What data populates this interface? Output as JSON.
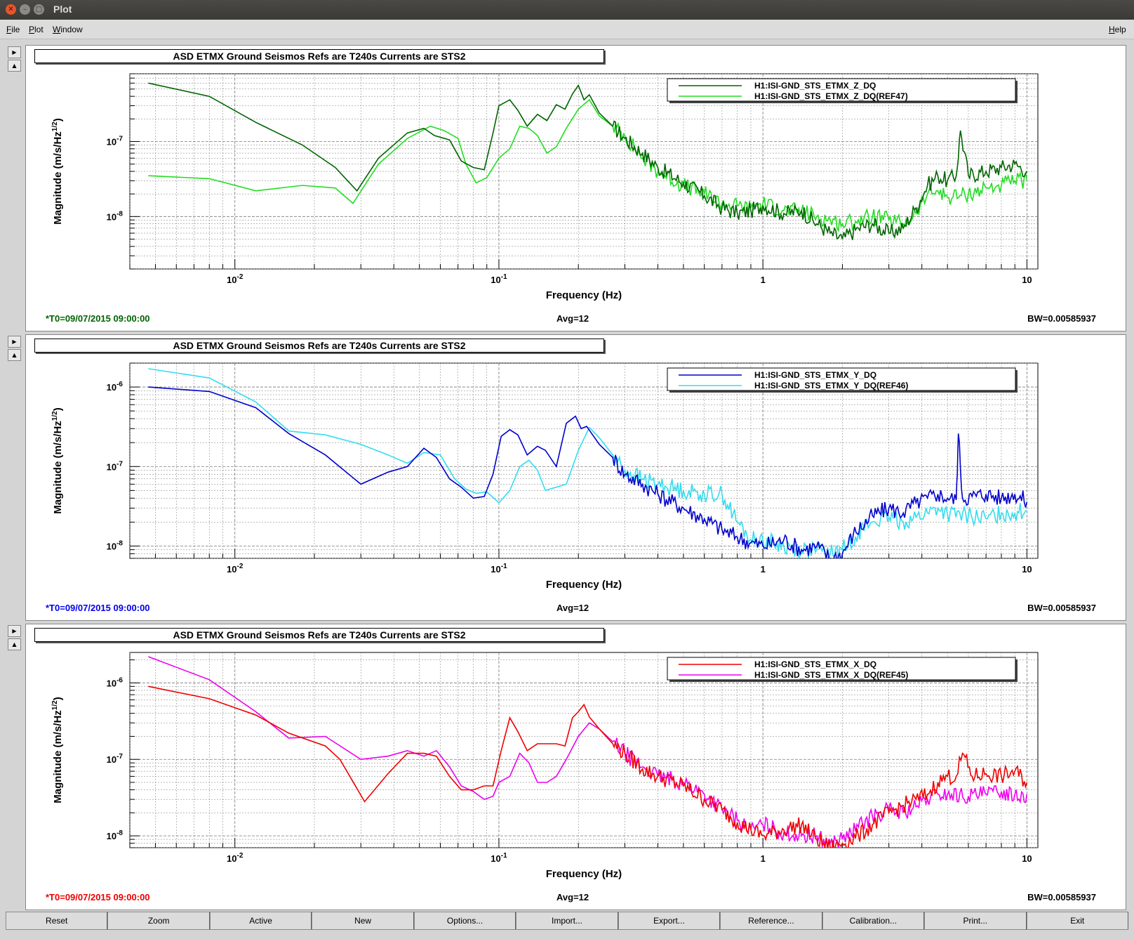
{
  "window": {
    "title": "Plot"
  },
  "menu": {
    "file": "File",
    "plot": "Plot",
    "window": "Window",
    "help": "Help"
  },
  "panels": [
    {
      "title": "ASD ETMX Ground Seismos Refs are T240s Currents are STS2",
      "t0": "*T0=09/07/2015 09:00:00",
      "avg": "Avg=12",
      "bw": "BW=0.00585937",
      "t0_color": "#006400"
    },
    {
      "title": "ASD ETMX Ground Seismos Refs are T240s Currents are STS2",
      "t0": "*T0=09/07/2015 09:00:00",
      "avg": "Avg=12",
      "bw": "BW=0.00585937",
      "t0_color": "#0000ee"
    },
    {
      "title": "ASD ETMX Ground Seismos Refs are T240s Currents are STS2",
      "t0": "*T0=09/07/2015 09:00:00",
      "avg": "Avg=12",
      "bw": "BW=0.00585937",
      "t0_color": "#ee0000"
    }
  ],
  "chart_data": [
    {
      "type": "line",
      "xlabel": "Frequency (Hz)",
      "ylabel": "Magnitude (m/s/Hz^1/2)",
      "xscale": "log",
      "yscale": "log",
      "xlim": [
        0.004,
        11
      ],
      "ylim": [
        2e-09,
        8e-07
      ],
      "xticks": [
        0.01,
        0.1,
        1,
        10
      ],
      "xtick_labels": [
        "10^-2",
        "10^-1",
        "1",
        "10"
      ],
      "yticks": [
        1e-08,
        1e-07
      ],
      "ytick_labels": [
        "10^-8",
        "10^-7"
      ],
      "grid": true,
      "legend_position": "top-right",
      "series": [
        {
          "name": "H1:ISI-GND_STS_ETMX_Z_DQ",
          "color": "#006400",
          "x": [
            0.0047,
            0.008,
            0.012,
            0.018,
            0.024,
            0.029,
            0.035,
            0.045,
            0.052,
            0.057,
            0.065,
            0.072,
            0.08,
            0.088,
            0.095,
            0.1,
            0.11,
            0.118,
            0.128,
            0.14,
            0.152,
            0.165,
            0.178,
            0.19,
            0.2,
            0.21,
            0.22,
            0.24,
            0.27,
            0.3,
            0.35,
            0.4,
            0.5,
            0.6,
            0.7,
            0.8,
            0.9,
            1.0,
            1.2,
            1.4,
            1.6,
            1.8,
            2.0,
            2.3,
            2.6,
            3.0,
            3.4,
            3.8,
            4.2,
            4.6,
            5.0,
            5.4,
            5.6,
            6.0,
            7.0,
            8.0,
            9.0,
            10.0
          ],
          "y": [
            6e-07,
            4e-07,
            1.8e-07,
            9e-08,
            4.5e-08,
            2.2e-08,
            6e-08,
            1.3e-07,
            1.5e-07,
            1.2e-07,
            1.05e-07,
            5.5e-08,
            4.5e-08,
            4.2e-08,
            1.3e-07,
            3e-07,
            3.6e-07,
            2.6e-07,
            1.6e-07,
            2.3e-07,
            1.9e-07,
            3.1e-07,
            2.7e-07,
            4.3e-07,
            5.6e-07,
            3.6e-07,
            4.2e-07,
            2.4e-07,
            1.6e-07,
            1.1e-07,
            7e-08,
            4.5e-08,
            2.8e-08,
            1.9e-08,
            1.3e-08,
            1.1e-08,
            1.2e-08,
            1.4e-08,
            1.1e-08,
            1.2e-08,
            8e-09,
            6e-09,
            5e-09,
            7e-09,
            8e-09,
            6e-09,
            7e-09,
            1.3e-08,
            2.6e-08,
            3.5e-08,
            3e-08,
            3.5e-08,
            1.4e-07,
            3.5e-08,
            4e-08,
            4.5e-08,
            5e-08,
            4e-08
          ]
        },
        {
          "name": "H1:ISI-GND_STS_ETMX_Z_DQ(REF47)",
          "color": "#22dd22",
          "x": [
            0.0047,
            0.008,
            0.012,
            0.018,
            0.024,
            0.028,
            0.035,
            0.045,
            0.055,
            0.062,
            0.07,
            0.075,
            0.082,
            0.09,
            0.1,
            0.11,
            0.12,
            0.13,
            0.14,
            0.152,
            0.165,
            0.18,
            0.2,
            0.22,
            0.24,
            0.27,
            0.3,
            0.35,
            0.4,
            0.5,
            0.6,
            0.7,
            0.8,
            0.9,
            1.0,
            1.2,
            1.4,
            1.6,
            1.8,
            2.0,
            2.3,
            2.6,
            3.0,
            3.4,
            3.8,
            4.2,
            4.6,
            5.0,
            6.0,
            7.0,
            8.0,
            9.0,
            10.0
          ],
          "y": [
            3.5e-08,
            3.2e-08,
            2.2e-08,
            2.6e-08,
            2.4e-08,
            1.5e-08,
            5e-08,
            1.1e-07,
            1.6e-07,
            1.4e-07,
            1.1e-07,
            5e-08,
            2.8e-08,
            3.3e-08,
            6e-08,
            8e-08,
            1.6e-07,
            1.5e-07,
            1.2e-07,
            7e-08,
            8.5e-08,
            1.5e-07,
            2.7e-07,
            3.6e-07,
            2.2e-07,
            1.6e-07,
            1.2e-07,
            6e-08,
            4e-08,
            2.6e-08,
            2e-08,
            1.5e-08,
            1.4e-08,
            1.3e-08,
            1.5e-08,
            1.2e-08,
            1.2e-08,
            1e-08,
            9e-09,
            8e-09,
            9e-09,
            1e-08,
            9e-09,
            8e-09,
            1.1e-08,
            2e-08,
            2.2e-08,
            1.8e-08,
            2e-08,
            2.4e-08,
            2.6e-08,
            3e-08,
            3e-08
          ]
        }
      ]
    },
    {
      "type": "line",
      "xlabel": "Frequency (Hz)",
      "ylabel": "Magnitude (m/s/Hz^1/2)",
      "xscale": "log",
      "yscale": "log",
      "xlim": [
        0.004,
        11
      ],
      "ylim": [
        7e-09,
        2e-06
      ],
      "xticks": [
        0.01,
        0.1,
        1,
        10
      ],
      "xtick_labels": [
        "10^-2",
        "10^-1",
        "1",
        "10"
      ],
      "yticks": [
        1e-08,
        1e-07,
        1e-06
      ],
      "ytick_labels": [
        "10^-8",
        "10^-7",
        "10^-6"
      ],
      "grid": true,
      "legend_position": "top-right",
      "series": [
        {
          "name": "H1:ISI-GND_STS_ETMX_Y_DQ",
          "color": "#0000cc",
          "x": [
            0.0047,
            0.008,
            0.012,
            0.016,
            0.022,
            0.03,
            0.038,
            0.045,
            0.052,
            0.058,
            0.065,
            0.072,
            0.08,
            0.088,
            0.095,
            0.102,
            0.11,
            0.118,
            0.128,
            0.14,
            0.15,
            0.165,
            0.18,
            0.195,
            0.205,
            0.215,
            0.24,
            0.27,
            0.3,
            0.35,
            0.4,
            0.5,
            0.6,
            0.7,
            0.8,
            0.9,
            1.0,
            1.2,
            1.4,
            1.6,
            1.8,
            2.0,
            2.2,
            2.6,
            3.0,
            3.4,
            3.8,
            4.2,
            4.6,
            5.0,
            5.4,
            5.5,
            5.7,
            6.2,
            7.0,
            8.0,
            9.0,
            10.0
          ],
          "y": [
            1e-06,
            8.8e-07,
            5.5e-07,
            2.6e-07,
            1.4e-07,
            6e-08,
            8.5e-08,
            1e-07,
            1.7e-07,
            1.3e-07,
            7e-08,
            5.5e-08,
            4e-08,
            4.2e-08,
            8e-08,
            2.4e-07,
            2.9e-07,
            2.5e-07,
            1.4e-07,
            1.8e-07,
            1.6e-07,
            1e-07,
            3.5e-07,
            4.3e-07,
            3e-07,
            3.2e-07,
            1.9e-07,
            1.3e-07,
            8e-08,
            6e-08,
            4.5e-08,
            3e-08,
            2.2e-08,
            1.6e-08,
            1.3e-08,
            1.1e-08,
            1e-08,
            1.2e-08,
            9e-09,
            1e-08,
            7e-09,
            8e-09,
            1.4e-08,
            2.4e-08,
            3e-08,
            2.6e-08,
            3.5e-08,
            4e-08,
            4.5e-08,
            4e-08,
            3.8e-08,
            2.6e-07,
            4e-08,
            4.2e-08,
            4.5e-08,
            4e-08,
            4.5e-08,
            3.6e-08
          ]
        },
        {
          "name": "H1:ISI-GND_STS_ETMX_Y_DQ(REF46)",
          "color": "#33ddee",
          "x": [
            0.0047,
            0.008,
            0.012,
            0.016,
            0.022,
            0.03,
            0.038,
            0.045,
            0.052,
            0.06,
            0.068,
            0.075,
            0.082,
            0.09,
            0.1,
            0.11,
            0.12,
            0.13,
            0.14,
            0.15,
            0.165,
            0.18,
            0.2,
            0.22,
            0.24,
            0.27,
            0.3,
            0.35,
            0.4,
            0.5,
            0.6,
            0.7,
            0.8,
            0.9,
            1.0,
            1.2,
            1.4,
            1.6,
            1.8,
            2.0,
            2.3,
            2.6,
            3.0,
            3.4,
            3.8,
            4.2,
            4.6,
            5.0,
            6.0,
            7.0,
            8.0,
            9.0,
            10.0
          ],
          "y": [
            1.7e-06,
            1.3e-06,
            6.5e-07,
            2.8e-07,
            2.5e-07,
            1.9e-07,
            1.4e-07,
            1.1e-07,
            1.5e-07,
            1.4e-07,
            7e-08,
            5.2e-08,
            4.6e-08,
            4.8e-08,
            3.5e-08,
            5e-08,
            1e-07,
            1.2e-07,
            9e-08,
            5e-08,
            5.5e-08,
            6e-08,
            1.6e-07,
            3.1e-07,
            2.3e-07,
            1.4e-07,
            9e-08,
            7e-08,
            6e-08,
            5e-08,
            4.5e-08,
            4.5e-08,
            2e-08,
            1.2e-08,
            1.2e-08,
            1e-08,
            9e-09,
            9e-09,
            8e-09,
            9e-09,
            1.5e-08,
            2e-08,
            2.3e-08,
            2e-08,
            2.3e-08,
            2.6e-08,
            3e-08,
            2.5e-08,
            2.4e-08,
            2.2e-08,
            2.6e-08,
            2.6e-08,
            2.8e-08
          ]
        }
      ]
    },
    {
      "type": "line",
      "xlabel": "Frequency (Hz)",
      "ylabel": "Magnitude (m/s/Hz^1/2)",
      "xscale": "log",
      "yscale": "log",
      "xlim": [
        0.004,
        11
      ],
      "ylim": [
        7e-09,
        2.5e-06
      ],
      "xticks": [
        0.01,
        0.1,
        1,
        10
      ],
      "xtick_labels": [
        "10^-2",
        "10^-1",
        "1",
        "10"
      ],
      "yticks": [
        1e-08,
        1e-07,
        1e-06
      ],
      "ytick_labels": [
        "10^-8",
        "10^-7",
        "10^-6"
      ],
      "grid": true,
      "legend_position": "top-right",
      "series": [
        {
          "name": "H1:ISI-GND_STS_ETMX_X_DQ",
          "color": "#ee0000",
          "x": [
            0.0047,
            0.008,
            0.012,
            0.016,
            0.022,
            0.025,
            0.031,
            0.038,
            0.045,
            0.052,
            0.058,
            0.065,
            0.072,
            0.08,
            0.088,
            0.095,
            0.102,
            0.11,
            0.118,
            0.128,
            0.14,
            0.152,
            0.165,
            0.178,
            0.19,
            0.2,
            0.21,
            0.22,
            0.24,
            0.27,
            0.3,
            0.35,
            0.4,
            0.5,
            0.6,
            0.7,
            0.8,
            0.9,
            1.0,
            1.2,
            1.4,
            1.6,
            1.8,
            2.0,
            2.3,
            2.6,
            3.0,
            3.4,
            3.8,
            4.2,
            4.6,
            5.0,
            5.4,
            5.7,
            6.2,
            7.0,
            8.0,
            9.0,
            10.0
          ],
          "y": [
            9e-07,
            6.2e-07,
            3.8e-07,
            2.2e-07,
            1.5e-07,
            1e-07,
            2.8e-08,
            6.5e-08,
            1.2e-07,
            1.2e-07,
            1.1e-07,
            6e-08,
            4e-08,
            4e-08,
            4.5e-08,
            4.5e-08,
            1.3e-07,
            3.5e-07,
            2.3e-07,
            1.3e-07,
            1.6e-07,
            1.6e-07,
            1.6e-07,
            1.5e-07,
            3.5e-07,
            4.2e-07,
            5.2e-07,
            3.6e-07,
            2.5e-07,
            1.6e-07,
            1.2e-07,
            7.5e-08,
            6e-08,
            4.5e-08,
            3e-08,
            2.2e-08,
            1.5e-08,
            1.2e-08,
            1e-08,
            1.2e-08,
            1.4e-08,
            9e-09,
            7e-09,
            8e-09,
            1e-08,
            1.4e-08,
            2e-08,
            2.5e-08,
            3e-08,
            3.5e-08,
            5e-08,
            6e-08,
            6e-08,
            1.2e-07,
            6e-08,
            6.5e-08,
            6e-08,
            7e-08,
            5e-08
          ]
        },
        {
          "name": "H1:ISI-GND_STS_ETMX_X_DQ(REF45)",
          "color": "#ee00ee",
          "x": [
            0.0047,
            0.008,
            0.012,
            0.016,
            0.022,
            0.03,
            0.038,
            0.045,
            0.052,
            0.058,
            0.065,
            0.072,
            0.08,
            0.088,
            0.095,
            0.1,
            0.11,
            0.12,
            0.13,
            0.14,
            0.152,
            0.165,
            0.18,
            0.2,
            0.22,
            0.24,
            0.27,
            0.3,
            0.35,
            0.4,
            0.5,
            0.6,
            0.7,
            0.8,
            0.9,
            1.0,
            1.2,
            1.4,
            1.6,
            1.8,
            2.0,
            2.3,
            2.6,
            3.0,
            3.4,
            3.8,
            4.2,
            4.6,
            5.0,
            6.0,
            7.0,
            8.0,
            9.0,
            10.0
          ],
          "y": [
            2.2e-06,
            1.1e-06,
            4.2e-07,
            1.9e-07,
            2e-07,
            1e-07,
            1.1e-07,
            1.3e-07,
            1.1e-07,
            1.3e-07,
            8e-08,
            4.5e-08,
            3.8e-08,
            3e-08,
            3.3e-08,
            5e-08,
            6e-08,
            1.2e-07,
            9e-08,
            5e-08,
            5e-08,
            6e-08,
            1e-07,
            2e-07,
            3e-07,
            2.5e-07,
            1.7e-07,
            1.2e-07,
            8e-08,
            6e-08,
            5e-08,
            3.5e-08,
            2.2e-08,
            1.6e-08,
            1.2e-08,
            1.4e-08,
            1.1e-08,
            1e-08,
            1e-08,
            8e-09,
            9e-09,
            1.3e-08,
            1.8e-08,
            2.2e-08,
            2e-08,
            2.4e-08,
            3e-08,
            3.5e-08,
            3.5e-08,
            3.3e-08,
            3.5e-08,
            3.8e-08,
            3.5e-08,
            3.5e-08
          ]
        }
      ]
    }
  ],
  "toolbar": [
    "Reset",
    "Zoom",
    "Active",
    "New",
    "Options...",
    "Import...",
    "Export...",
    "Reference...",
    "Calibration...",
    "Print...",
    "Exit"
  ]
}
